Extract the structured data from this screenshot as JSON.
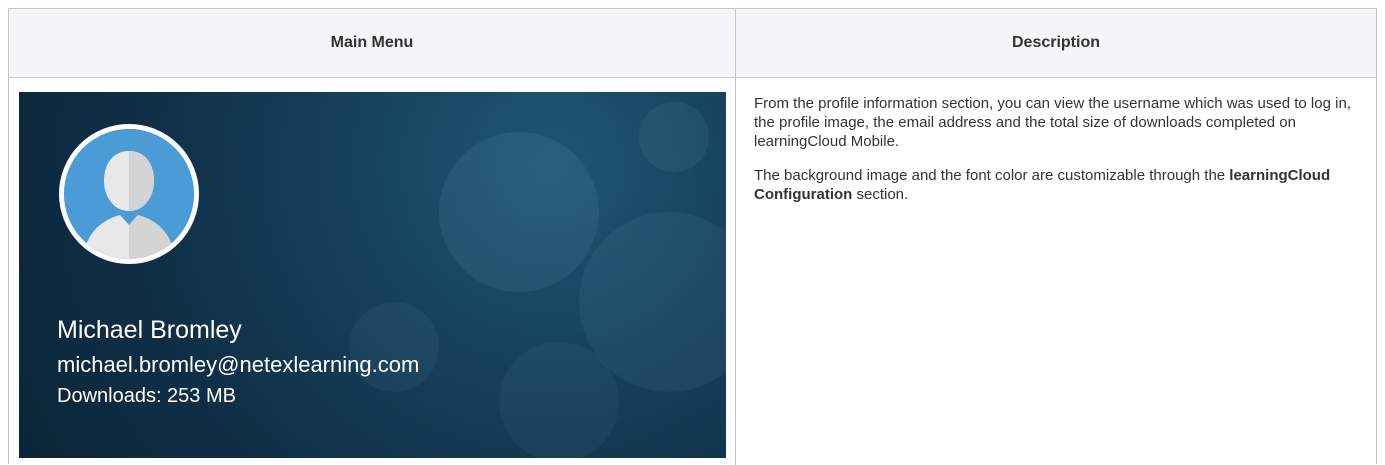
{
  "table": {
    "headers": [
      "Main Menu",
      "Description"
    ]
  },
  "profile": {
    "name": "Michael Bromley",
    "email": "michael.bromley@netexlearning.com",
    "downloads": "Downloads: 253 MB",
    "avatar_icon": "user-avatar-icon",
    "background_color": "#16405a",
    "avatar_color": "#4b9bd6"
  },
  "description": {
    "paragraph1": "From the profile information section, you can view the username which was used to log in, the profile image, the email address and the total size of downloads completed on learningCloud Mobile.",
    "paragraph2_prefix": "The background image and the font color are customizable through the ",
    "paragraph2_bold": "learningCloud Configuration",
    "paragraph2_suffix": " section."
  }
}
